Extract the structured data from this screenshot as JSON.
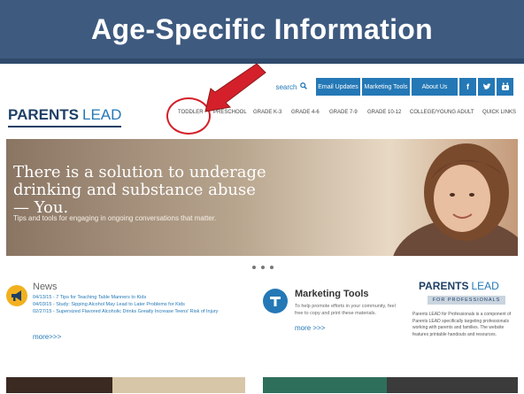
{
  "slide": {
    "title": "Age-Specific Information"
  },
  "topbar": {
    "search_label": "search",
    "buttons": [
      "Email Updates",
      "Marketing Tools",
      "About Us"
    ],
    "social": [
      "f",
      "t",
      "yt"
    ]
  },
  "logo": {
    "part1": "PARENTS",
    "part2": "LEAD"
  },
  "nav": {
    "items": [
      "TODDLER",
      "PRESCHOOL",
      "GRADE K-3",
      "GRADE 4-6",
      "GRADE 7-9",
      "GRADE 10-12",
      "COLLEGE/YOUNG ADULT",
      "QUICK LINKS"
    ]
  },
  "hero": {
    "headline": "There is a solution to underage drinking and substance abuse — You.",
    "subtext": "Tips and tools for engaging in ongoing conversations that matter."
  },
  "news": {
    "title": "News",
    "items": [
      "04/13/15 - 7 Tips for Teaching Table Manners to Kids",
      "04/03/15 - Study: Sipping Alcohol May Lead to Later Problems for Kids",
      "02/27/15 - Supersized Flavored Alcoholic Drinks Greatly Increase Teens' Risk of Injury"
    ],
    "more": "more>>>"
  },
  "marketing": {
    "title": "Marketing Tools",
    "description": "To help promote efforts in your community, feel free to copy and print these materials.",
    "more": "more >>>"
  },
  "professionals": {
    "logo_part1": "PARENTS",
    "logo_part2": "LEAD",
    "tag": "FOR PROFESSIONALS",
    "description": "Parents LEAD for Professionals is a component of Parents LEAD specifically targeting professionals working with parents and families. The website features printable handouts and resources."
  },
  "colors": {
    "slide_header": "#3e5a7f",
    "brand_blue": "#2478b6",
    "brand_navy": "#1e3f66",
    "highlight_red": "#d4202a"
  }
}
